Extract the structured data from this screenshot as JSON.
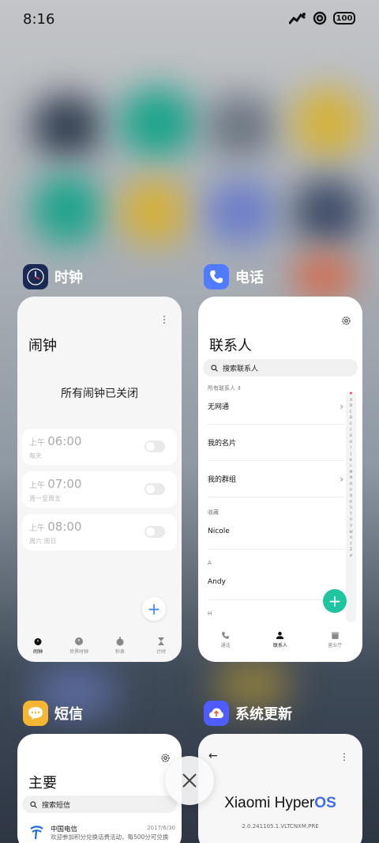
{
  "status_bar": {
    "time": "8:16",
    "battery": "100"
  },
  "colors": {
    "accent_blue": "#3d82f5",
    "accent_teal": "#1fc4a0",
    "sms_yellow": "#f5b731",
    "phone_blue": "#4e7bff",
    "update_blue": "#4f5cff"
  },
  "clock_app": {
    "name": "时钟",
    "title": "闹钟",
    "empty_message": "所有闹钟已关闭",
    "alarms": [
      {
        "period": "上午",
        "time": "06:00",
        "repeat": "每天"
      },
      {
        "period": "上午",
        "time": "07:00",
        "repeat": "周一至周五"
      },
      {
        "period": "上午",
        "time": "08:00",
        "repeat": "周六 周日"
      }
    ],
    "add_label": "+",
    "nav": [
      "闹钟",
      "世界时钟",
      "秒表",
      "计时"
    ]
  },
  "phone_app": {
    "name": "电话",
    "title": "联系人",
    "search_placeholder": "搜索联系人",
    "all_contacts_label": "所有联系人 ⇕",
    "rows": [
      "无网通",
      "我的名片",
      "我的群组"
    ],
    "favorites_label": "收藏",
    "favorite_contact": "Nicole",
    "section_a": "A",
    "contact_a": "Andy",
    "section_h": "H",
    "add_label": "+",
    "index_letters": [
      "♥",
      "A",
      "B",
      "C",
      "D",
      "E",
      "F",
      "G",
      "H",
      "I",
      "J",
      "K",
      "L",
      "M",
      "N",
      "O",
      "P",
      "Q",
      "R",
      "S",
      "T",
      "U",
      "V",
      "W",
      "X",
      "Y",
      "Z",
      "#"
    ],
    "nav": [
      "通话",
      "联系人",
      "营业厅"
    ]
  },
  "sms_app": {
    "name": "短信",
    "title": "主要",
    "search_placeholder": "搜索短信",
    "message": {
      "sender": "中国电信",
      "date": "2017/6/30",
      "preview": "欢迎参加积分兑换话费活动，每500分可兑换"
    }
  },
  "update_app": {
    "name": "系统更新",
    "brand_prefix": "Xiaomi Hyper",
    "brand_suffix": "OS",
    "version": "2.0.241105.1.VLTCNXM.PRE"
  }
}
